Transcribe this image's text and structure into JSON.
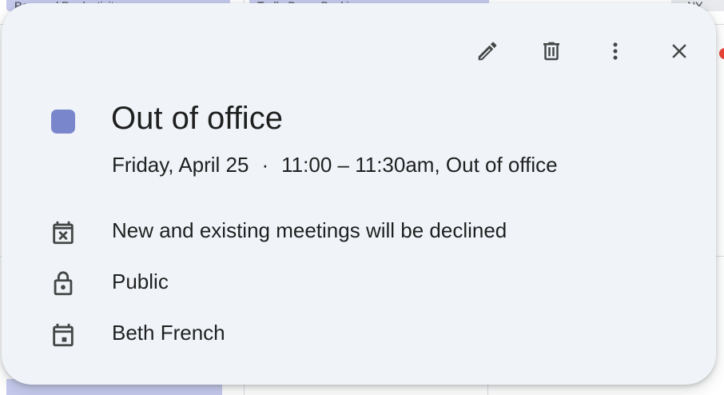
{
  "background": {
    "chips": [
      "Personal Productivity",
      "Trello Demo Booki"
    ],
    "corner_text": "NY"
  },
  "toolbar": {
    "edit_icon": "pencil-icon",
    "delete_icon": "trash-icon",
    "more_icon": "more-vert-icon",
    "close_icon": "close-icon"
  },
  "event": {
    "color": "#7986cb",
    "title": "Out of office",
    "date": "Friday, April 25",
    "separator": "·",
    "time": "11:00 – 11:30am, Out of office"
  },
  "details": [
    {
      "icon": "calendar-x-icon",
      "text": "New and existing meetings will be declined"
    },
    {
      "icon": "lock-icon",
      "text": "Public"
    },
    {
      "icon": "calendar-icon",
      "text": "Beth French"
    }
  ]
}
